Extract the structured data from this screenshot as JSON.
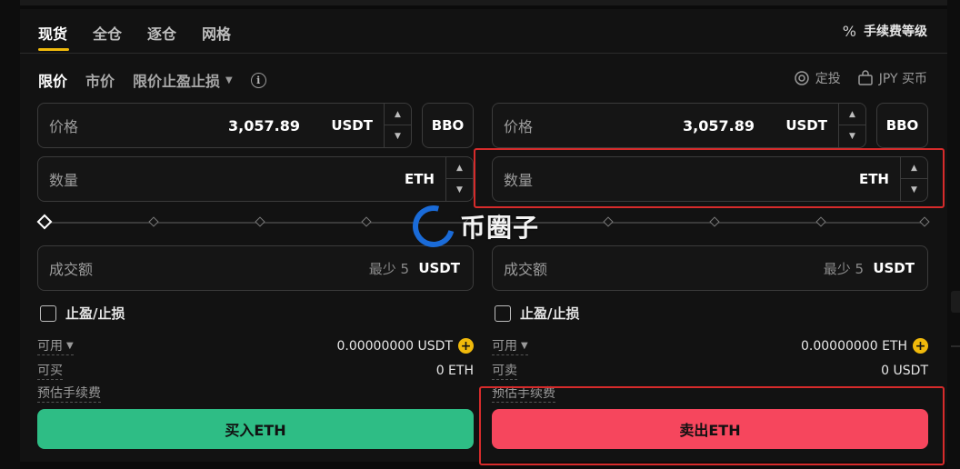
{
  "tabs": [
    "现货",
    "全仓",
    "逐仓",
    "网格"
  ],
  "fee_level": {
    "icon": "percent-icon",
    "label": "手续费等级"
  },
  "order_types": {
    "limit": "限价",
    "market": "市价",
    "stop_limit": "限价止盈止损"
  },
  "right_actions": {
    "dca": "定投",
    "buy_crypto": "JPY 买币"
  },
  "buy": {
    "price": {
      "label": "价格",
      "value": "3,057.89",
      "unit": "USDT"
    },
    "bbo": "BBO",
    "amount": {
      "label": "数量",
      "unit": "ETH"
    },
    "total": {
      "label": "成交额",
      "hint": "最少 5",
      "unit": "USDT"
    },
    "tpsl": "止盈/止损",
    "available": {
      "label": "可用",
      "value": "0.00000000 USDT"
    },
    "max": {
      "label": "可买",
      "value": "0 ETH"
    },
    "est_fee": {
      "label": "预估手续费",
      "value": ""
    },
    "button": "买入ETH"
  },
  "sell": {
    "price": {
      "label": "价格",
      "value": "3,057.89",
      "unit": "USDT"
    },
    "bbo": "BBO",
    "amount": {
      "label": "数量",
      "unit": "ETH"
    },
    "total": {
      "label": "成交额",
      "hint": "最少 5",
      "unit": "USDT"
    },
    "tpsl": "止盈/止损",
    "available": {
      "label": "可用",
      "value": "0.00000000 ETH"
    },
    "max": {
      "label": "可卖",
      "value": "0 USDT"
    },
    "est_fee": {
      "label": "预估手续费",
      "value": ""
    },
    "button": "卖出ETH"
  },
  "watermark": "币圈子",
  "colors": {
    "accent": "#f0b90b",
    "buy": "#2ebd85",
    "sell": "#f6465d",
    "highlight": "#d62b2b"
  }
}
